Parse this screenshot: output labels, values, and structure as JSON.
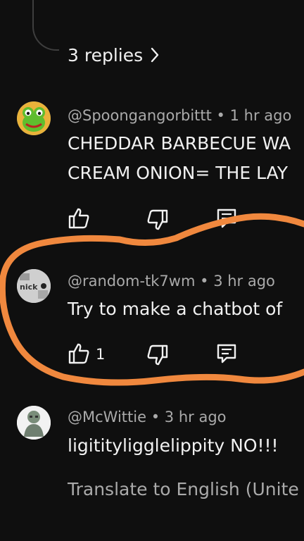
{
  "thread": {
    "replies_label": "3 replies"
  },
  "comments": [
    {
      "author": "@Spoongangorbittt",
      "time": "1 hr ago",
      "lines": [
        "CHEDDAR BARBECUE WA",
        "CREAM ONION= THE LAY"
      ],
      "likes": ""
    },
    {
      "author": "@random-tk7wm",
      "time": "3 hr ago",
      "lines": [
        "Try to make a chatbot of"
      ],
      "likes": "1",
      "avatar_text": "nick"
    },
    {
      "author": "@McWittie",
      "time": "3 hr ago",
      "lines": [
        "ligitityligglelippity NO!!!"
      ],
      "translate": "Translate to English (Unite"
    }
  ],
  "separator": "•",
  "colors": {
    "background": "#0f0f0f",
    "text": "#f1f1f1",
    "secondary": "#aaaaaa",
    "annotation": "#f0883e",
    "kermit": "#5fbd2e"
  }
}
